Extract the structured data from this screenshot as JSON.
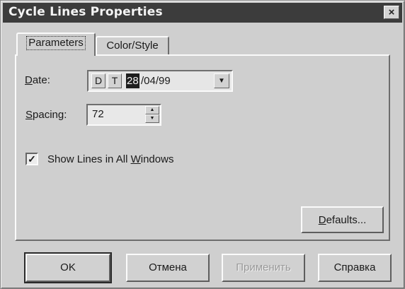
{
  "window": {
    "title": "Cycle Lines Properties",
    "close_glyph": "×"
  },
  "tabs": [
    {
      "label": "Parameters",
      "active": true
    },
    {
      "label": "Color/Style",
      "active": false
    }
  ],
  "date": {
    "label_underlined": "D",
    "label_rest": "ate:",
    "d_button": "D",
    "t_button": "T",
    "day": "28",
    "rest": "/04/99",
    "dropdown_glyph": "▼"
  },
  "spacing": {
    "label_underlined": "S",
    "label_rest": "pacing:",
    "value": "72",
    "up_glyph": "▲",
    "down_glyph": "▼"
  },
  "show_lines": {
    "checked": true,
    "check_glyph": "✓",
    "label_prefix": "Show Lines in All ",
    "label_underlined": "W",
    "label_suffix": "indows"
  },
  "defaults_button": {
    "label_underlined": "D",
    "label_rest": "efaults..."
  },
  "buttons": {
    "ok": "OK",
    "cancel": "Отмена",
    "apply": "Применить",
    "help": "Справка"
  },
  "icons": [
    "close-icon",
    "dropdown-arrow-icon",
    "spin-up-icon",
    "spin-down-icon",
    "checkmark-icon"
  ]
}
